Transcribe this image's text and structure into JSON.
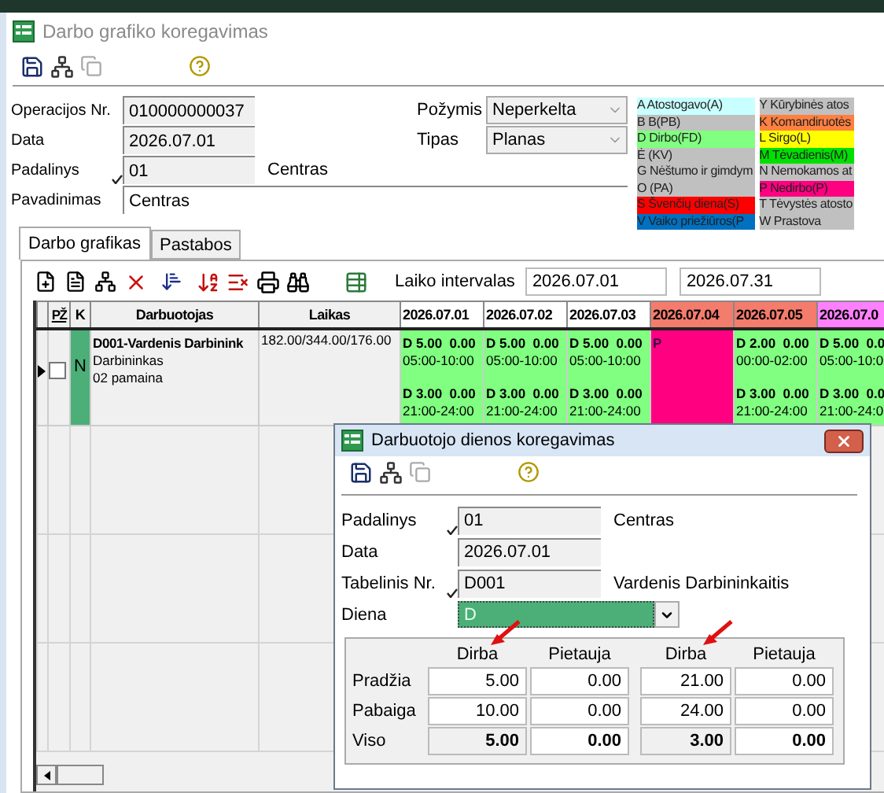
{
  "window": {
    "title": "Darbo grafiko koregavimas"
  },
  "form": {
    "fields": [
      {
        "label": "Operacijos Nr.",
        "value": "010000000037",
        "validated": false
      },
      {
        "label": "Data",
        "value": "2026.07.01",
        "validated": false
      },
      {
        "label": "Padalinys",
        "value": "01",
        "validated": true,
        "note": "Centras"
      }
    ],
    "selects": [
      {
        "label": "Požymis",
        "value": "Neperkelta"
      },
      {
        "label": "Tipas",
        "value": "Planas"
      }
    ],
    "name_field": {
      "label": "Pavadinimas",
      "value": "Centras"
    }
  },
  "legend": [
    {
      "items": [
        {
          "label": "A Atostogavo(A)",
          "color": "#c8ffff"
        },
        {
          "label": "B B(PB)",
          "color": "#c0c0c0"
        },
        {
          "label": "D Dirbo(FD)",
          "color": "#80ff80"
        },
        {
          "label": "Ė (KV)",
          "color": "#c0c0c0"
        },
        {
          "label": "G Nėštumo ir gimdym",
          "color": "#c0c0c0"
        },
        {
          "label": "O (PA)",
          "color": "#c0c0c0"
        },
        {
          "label": "S Švenčių diena(S)",
          "color": "#ff0000"
        },
        {
          "label": "V Vaiko priežiūros(P",
          "color": "#0070c0"
        }
      ]
    },
    {
      "items": [
        {
          "label": "Y Kūrybinės atos",
          "color": "#c0c0c0"
        },
        {
          "label": "K Komandiruotės",
          "color": "#ff8040"
        },
        {
          "label": "L Sirgo(L)",
          "color": "#ffff00"
        },
        {
          "label": "M Tėvadienis(M)",
          "color": "#00e000"
        },
        {
          "label": "N Nemokamos at",
          "color": "#c0c0c0"
        },
        {
          "label": "P Nedirbo(P)",
          "color": "#ff0080"
        },
        {
          "label": "T Tėvystės atosto",
          "color": "#c0c0c0"
        },
        {
          "label": "W Prastova",
          "color": "#c0c0c0"
        }
      ]
    }
  ],
  "tabs": [
    {
      "label": "Darbo grafikas",
      "selected": true
    },
    {
      "label": "Pastabos",
      "selected": false
    }
  ],
  "interval": {
    "label": "Laiko intervalas",
    "from": "2026.07.01",
    "to": "2026.07.31"
  },
  "table": {
    "columns": [
      {
        "label": "PŽ"
      },
      {
        "label": "K"
      },
      {
        "label": "Darbuotojas"
      },
      {
        "label": "Laikas"
      }
    ],
    "dates": [
      {
        "label": "2026.07.01",
        "color": "#ffffff"
      },
      {
        "label": "2026.07.02",
        "color": "#ffffff"
      },
      {
        "label": "2026.07.03",
        "color": "#ffffff"
      },
      {
        "label": "2026.07.04",
        "color": "#f47c6c"
      },
      {
        "label": "2026.07.05",
        "color": "#f47c6c"
      },
      {
        "label": "2026.07.0",
        "color": "#ff80ff"
      }
    ],
    "rows": [
      {
        "selected": true,
        "checked": false,
        "k": {
          "label": "N",
          "color": "#4caf78"
        },
        "name": "D001-Vardenis Darbinink",
        "lines": [
          "Darbininkas",
          "02 pamaina"
        ],
        "laikas": "182.00/344.00/176.00",
        "days": [
          {
            "color": "#80ff80",
            "shifts": [
              {
                "code": "D 5.00  0.00",
                "time": "05:00-10:00"
              },
              {
                "code": "D 3.00  0.00",
                "time": "21:00-24:00"
              }
            ]
          },
          {
            "color": "#80ff80",
            "shifts": [
              {
                "code": "D 5.00  0.00",
                "time": "05:00-10:00"
              },
              {
                "code": "D 3.00  0.00",
                "time": "21:00-24:00"
              }
            ]
          },
          {
            "color": "#80ff80",
            "shifts": [
              {
                "code": "D 5.00  0.00",
                "time": "05:00-10:00"
              },
              {
                "code": "D 3.00  0.00",
                "time": "21:00-24:00"
              }
            ]
          },
          {
            "color": "#ff0080",
            "shifts": [
              {
                "code": "P"
              }
            ]
          },
          {
            "color": "#80ff80",
            "shifts": [
              {
                "code": "D 2.00  0.00",
                "time": "00:00-02:00"
              },
              {
                "code": "D 3.00  0.00",
                "time": "21:00-24:00"
              }
            ]
          },
          {
            "color": "#80ff80",
            "shifts": [
              {
                "code": "D 5.00  0.0",
                "time": "05:00-10:0"
              },
              {
                "code": "D 3.00  0.0",
                "time": "21:00-24:0"
              }
            ]
          }
        ]
      }
    ]
  },
  "dialog": {
    "title": "Darbuotojo dienos koregavimas",
    "fields": [
      {
        "label": "Padalinys",
        "value": "01",
        "validated": true,
        "note": "Centras"
      },
      {
        "label": "Data",
        "value": "2026.07.01",
        "validated": false
      },
      {
        "label": "Tabelinis Nr.",
        "value": "D001",
        "validated": true,
        "note": "Vardenis Darbininkaitis"
      }
    ],
    "day": {
      "label": "Diena",
      "value": "D",
      "color": "#4caf78"
    },
    "grid": {
      "columns": [
        {
          "label": "Dirba",
          "marked": true
        },
        {
          "label": "Pietauja",
          "marked": false
        },
        {
          "label": "Dirba",
          "marked": true
        },
        {
          "label": "Pietauja",
          "marked": false
        }
      ],
      "rows": [
        {
          "label": "Pradžia",
          "kind": "input",
          "values": [
            "5.00",
            "0.00",
            "21.00",
            "0.00"
          ]
        },
        {
          "label": "Pabaiga",
          "kind": "input",
          "values": [
            "10.00",
            "0.00",
            "24.00",
            "0.00"
          ]
        },
        {
          "label": "Viso",
          "kind": "total",
          "values": [
            "5.00",
            "0.00",
            "3.00",
            "0.00"
          ]
        }
      ]
    }
  }
}
